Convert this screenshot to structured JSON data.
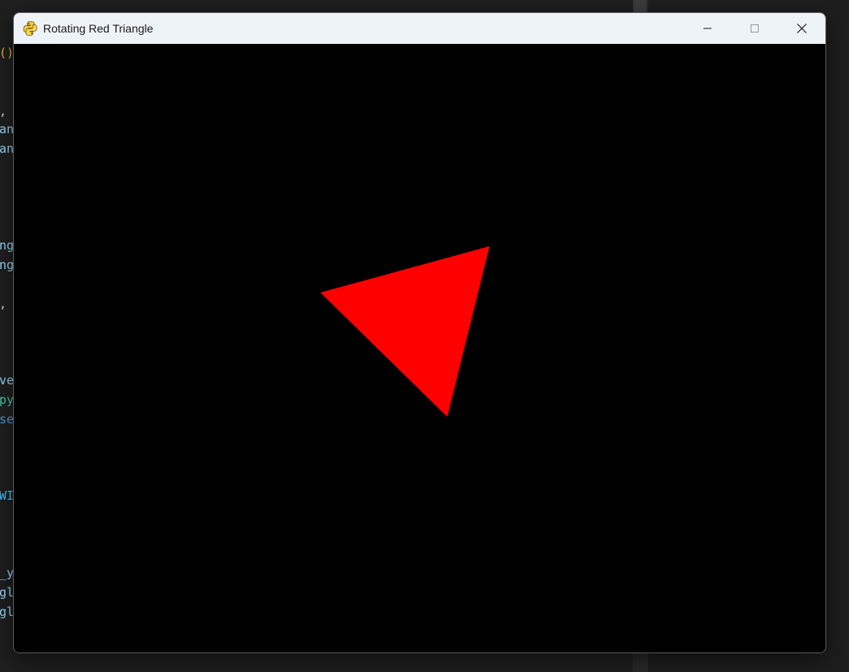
{
  "window": {
    "title": "Rotating Red Triangle",
    "icon": "pygame-snake-icon",
    "buttons": {
      "minimize_icon": "minimize-icon",
      "maximize_icon": "maximize-icon",
      "close_icon": "close-icon"
    }
  },
  "canvas": {
    "background": "#000000",
    "triangle_color": "#ff0000"
  },
  "editor_fragments": [
    {
      "text": "()",
      "color": "#e8b93b"
    },
    {
      "text": ",",
      "color": "#d4d4d4"
    },
    {
      "text": "an",
      "color": "#9cdcfe"
    },
    {
      "text": "an",
      "color": "#9cdcfe"
    },
    {
      "text": "ng",
      "color": "#9cdcfe"
    },
    {
      "text": "ng",
      "color": "#9cdcfe"
    },
    {
      "text": ",",
      "color": "#d4d4d4"
    },
    {
      "text": "ve",
      "color": "#9cdcfe"
    },
    {
      "text": "py",
      "color": "#4ec9b0"
    },
    {
      "text": "se",
      "color": "#569cd6"
    },
    {
      "text": "WI",
      "color": "#4fc1ff"
    },
    {
      "text": "_y",
      "color": "#9cdcfe"
    },
    {
      "text": "gl",
      "color": "#9cdcfe"
    },
    {
      "text": "gl",
      "color": "#9cdcfe"
    }
  ]
}
